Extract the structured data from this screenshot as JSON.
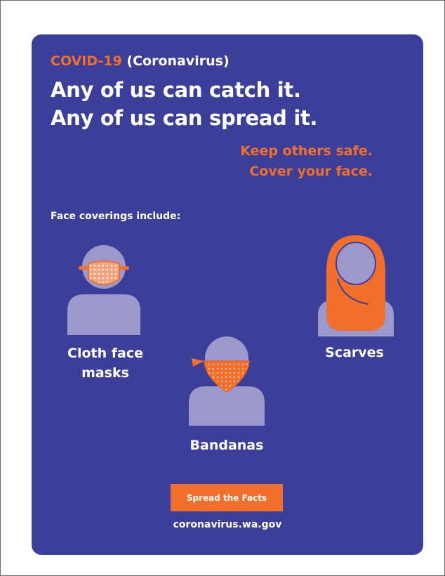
{
  "poster": {
    "topic_accent": "COVID-19",
    "topic_rest": " (Coronavirus)",
    "headline_1": "Any of us can catch it.",
    "headline_2": "Any of us can spread it.",
    "tagline_1": "Keep others safe.",
    "tagline_2": "Cover your face.",
    "subheading": "Face coverings include:",
    "items": [
      {
        "label_line_1": "Cloth face",
        "label_line_2": "masks",
        "icon": "cloth-mask-person-icon"
      },
      {
        "label": "Bandanas",
        "icon": "bandana-person-icon"
      },
      {
        "label": "Scarves",
        "icon": "scarf-person-icon"
      }
    ],
    "cta_label": "Spread the Facts",
    "url": "coronavirus.wa.gov"
  },
  "colors": {
    "background": "#3b3f9a",
    "accent": "#f26f2b",
    "figure": "#9d98cc",
    "text": "#ffffff"
  }
}
